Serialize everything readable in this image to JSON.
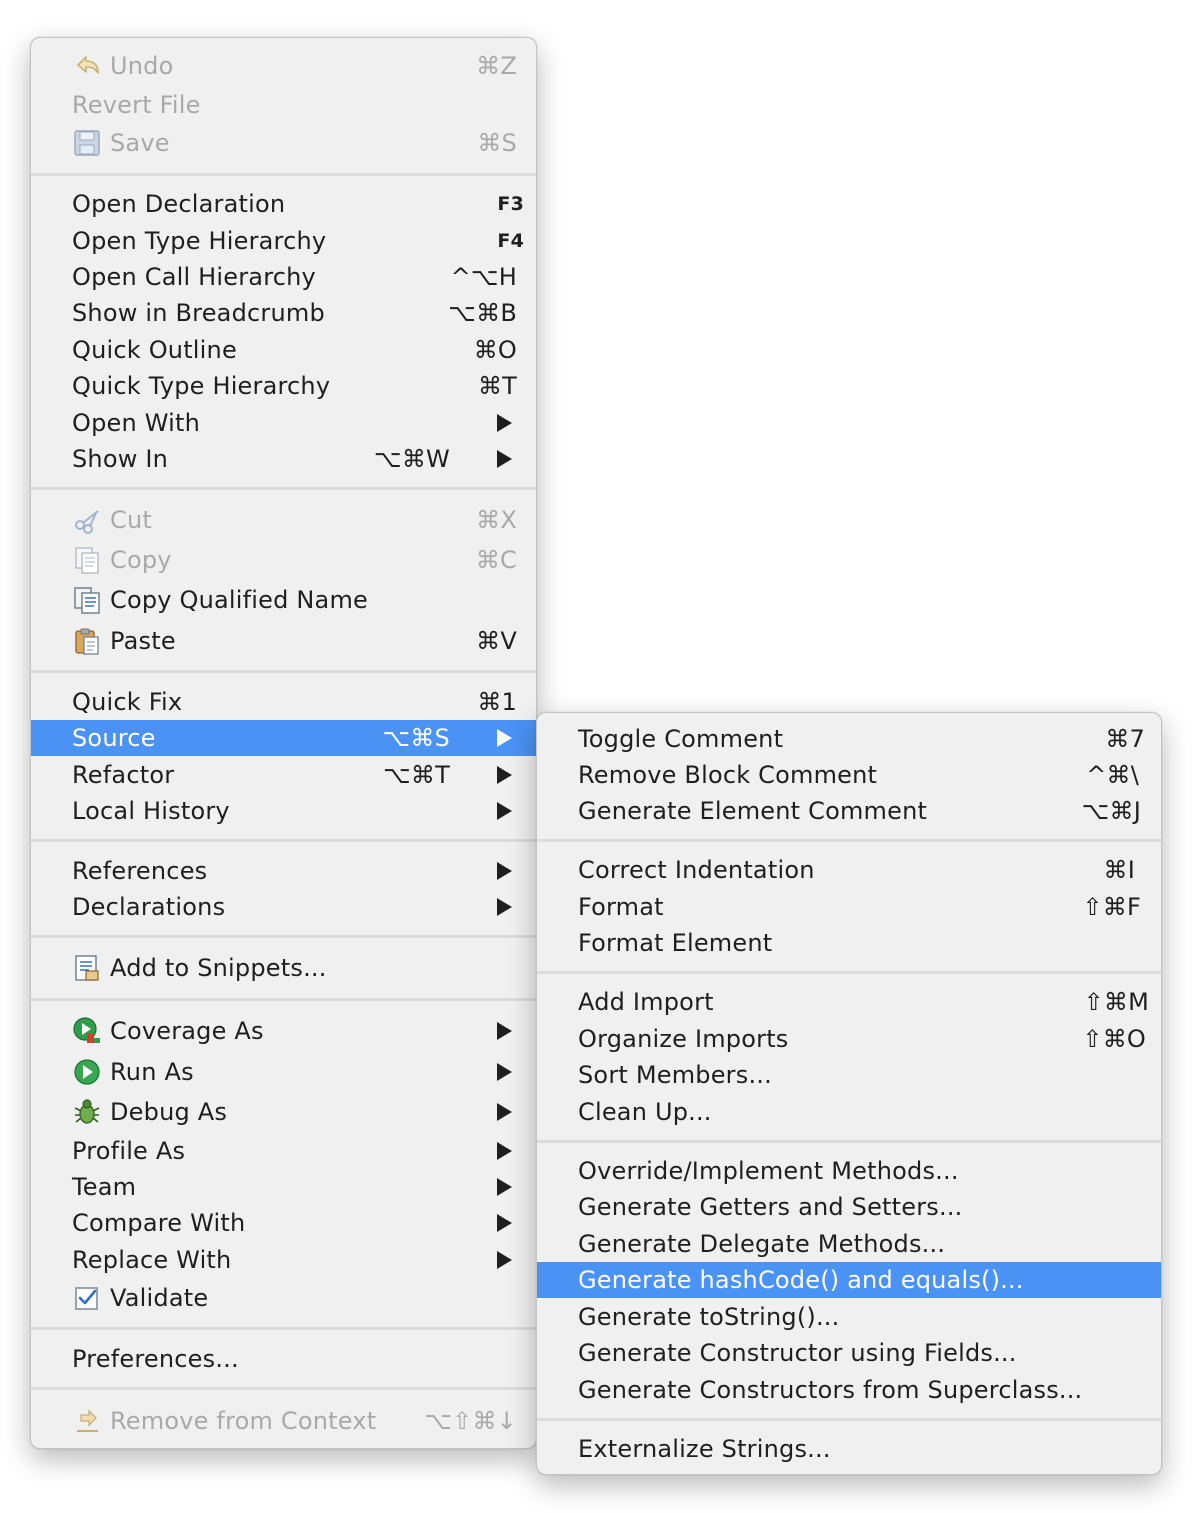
{
  "main_menu": {
    "undo": {
      "label": "Undo",
      "shortcut": "⌘Z",
      "icon": "undo-arrow-icon"
    },
    "revert_file": {
      "label": "Revert File"
    },
    "save": {
      "label": "Save",
      "shortcut": "⌘S",
      "icon": "floppy-disk-icon"
    },
    "open_declaration": {
      "label": "Open Declaration",
      "shortcut": "F3"
    },
    "open_type_hierarchy": {
      "label": "Open Type Hierarchy",
      "shortcut": "F4"
    },
    "open_call_hierarchy": {
      "label": "Open Call Hierarchy",
      "shortcut": "^⌥H"
    },
    "show_in_breadcrumb": {
      "label": "Show in Breadcrumb",
      "shortcut": "⌥⌘B"
    },
    "quick_outline": {
      "label": "Quick Outline",
      "shortcut": "⌘O"
    },
    "quick_type_hierarchy": {
      "label": "Quick Type Hierarchy",
      "shortcut": "⌘T"
    },
    "open_with": {
      "label": "Open With"
    },
    "show_in": {
      "label": "Show In",
      "shortcut": "⌥⌘W"
    },
    "cut": {
      "label": "Cut",
      "shortcut": "⌘X",
      "icon": "scissors-icon"
    },
    "copy": {
      "label": "Copy",
      "shortcut": "⌘C",
      "icon": "copy-icon"
    },
    "copy_qualified_name": {
      "label": "Copy Qualified Name",
      "icon": "copy-qualified-icon"
    },
    "paste": {
      "label": "Paste",
      "shortcut": "⌘V",
      "icon": "clipboard-icon"
    },
    "quick_fix": {
      "label": "Quick Fix",
      "shortcut": "⌘1"
    },
    "source": {
      "label": "Source",
      "shortcut": "⌥⌘S"
    },
    "refactor": {
      "label": "Refactor",
      "shortcut": "⌥⌘T"
    },
    "local_history": {
      "label": "Local History"
    },
    "references": {
      "label": "References"
    },
    "declarations": {
      "label": "Declarations"
    },
    "add_to_snippets": {
      "label": "Add to Snippets...",
      "icon": "snippet-icon"
    },
    "coverage_as": {
      "label": "Coverage As",
      "icon": "coverage-icon"
    },
    "run_as": {
      "label": "Run As",
      "icon": "run-icon"
    },
    "debug_as": {
      "label": "Debug As",
      "icon": "bug-icon"
    },
    "profile_as": {
      "label": "Profile As"
    },
    "team": {
      "label": "Team"
    },
    "compare_with": {
      "label": "Compare With"
    },
    "replace_with": {
      "label": "Replace With"
    },
    "validate": {
      "label": "Validate",
      "icon": "checkbox-checked-icon"
    },
    "preferences": {
      "label": "Preferences..."
    },
    "remove_from_context": {
      "label": "Remove from Context",
      "shortcut": "⌥⇧⌘↓",
      "icon": "remove-context-icon"
    }
  },
  "sub_menu": {
    "toggle_comment": {
      "label": "Toggle Comment",
      "shortcut": "⌘7"
    },
    "remove_block_comment": {
      "label": "Remove Block Comment",
      "shortcut": "^⌘\\"
    },
    "generate_element_comment": {
      "label": "Generate Element Comment",
      "shortcut": "⌥⌘J"
    },
    "correct_indentation": {
      "label": "Correct Indentation",
      "shortcut": "⌘I"
    },
    "format": {
      "label": "Format",
      "shortcut": "⇧⌘F"
    },
    "format_element": {
      "label": "Format Element"
    },
    "add_import": {
      "label": "Add Import",
      "shortcut": "⇧⌘M"
    },
    "organize_imports": {
      "label": "Organize Imports",
      "shortcut": "⇧⌘O"
    },
    "sort_members": {
      "label": "Sort Members..."
    },
    "clean_up": {
      "label": "Clean Up..."
    },
    "override_implement": {
      "label": "Override/Implement Methods..."
    },
    "getters_setters": {
      "label": "Generate Getters and Setters..."
    },
    "delegate_methods": {
      "label": "Generate Delegate Methods..."
    },
    "hashcode_equals": {
      "label": "Generate hashCode() and equals()..."
    },
    "to_string": {
      "label": "Generate toString()..."
    },
    "constructor_fields": {
      "label": "Generate Constructor using Fields..."
    },
    "constructors_superclass": {
      "label": "Generate Constructors from Superclass..."
    },
    "externalize_strings": {
      "label": "Externalize Strings..."
    }
  },
  "colors": {
    "highlight": "#4b92f5",
    "menu_bg": "#f0f0f0",
    "disabled_text": "#a9a9a9",
    "text": "#1f1f1f"
  }
}
